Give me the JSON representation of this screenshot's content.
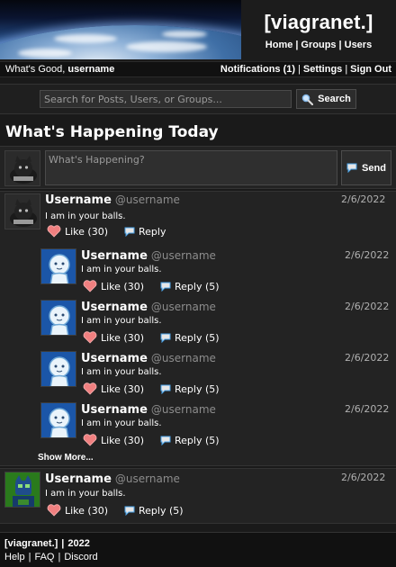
{
  "header": {
    "brand": "[viagranet.]",
    "nav": [
      "Home",
      "Groups",
      "Users"
    ]
  },
  "userbar": {
    "greeting": "What's Good,",
    "username": "username",
    "notifications": "Notifications (1)",
    "settings": "Settings",
    "sign_out": "Sign Out"
  },
  "search": {
    "placeholder": "Search for Posts, Users, or Groups...",
    "button_label": "Search"
  },
  "main": {
    "title": "What's Happening Today"
  },
  "compose": {
    "placeholder": "What's Happening?",
    "send_label": "Send"
  },
  "posts": [
    {
      "name": "Username",
      "handle": "@username",
      "date": "2/6/2022",
      "body": "I am in your balls.",
      "like_label": "Like (30)",
      "reply_label": "Reply",
      "avatar": "dark-cat"
    },
    {
      "name": "Username",
      "handle": "@username",
      "date": "2/6/2022",
      "body": "I am in your balls.",
      "like_label": "Like (30)",
      "reply_label": "Reply (5)",
      "avatar": "blue-cat"
    },
    {
      "name": "Username",
      "handle": "@username",
      "date": "2/6/2022",
      "body": "I am in your balls.",
      "like_label": "Like (30)",
      "reply_label": "Reply (5)",
      "avatar": "blue-cat"
    },
    {
      "name": "Username",
      "handle": "@username",
      "date": "2/6/2022",
      "body": "I am in your balls.",
      "like_label": "Like (30)",
      "reply_label": "Reply (5)",
      "avatar": "blue-cat"
    },
    {
      "name": "Username",
      "handle": "@username",
      "date": "2/6/2022",
      "body": "I am in your balls.",
      "like_label": "Like (30)",
      "reply_label": "Reply (5)",
      "avatar": "blue-cat"
    },
    {
      "name": "Username",
      "handle": "@username",
      "date": "2/6/2022",
      "body": "I am in your balls.",
      "like_label": "Like (30)",
      "reply_label": "Reply (5)",
      "avatar": "green-character"
    }
  ],
  "thread": {
    "show_more_label": "Show More..."
  },
  "footer": {
    "brand": "[viagranet.]",
    "year": "2022",
    "links": [
      "Help",
      "FAQ",
      "Discord"
    ]
  },
  "colors": {
    "background": "#1a1a1a",
    "panel": "#232323",
    "heart": "#f08080",
    "reply_icon": "#4aa3e8",
    "avatar_blue": "#1b56a8",
    "avatar_green": "#2a7a1c"
  },
  "icons": {
    "search": "magnifier-icon",
    "send": "speech-bubble-icon",
    "like": "heart-icon",
    "reply": "speech-bubble-icon"
  }
}
